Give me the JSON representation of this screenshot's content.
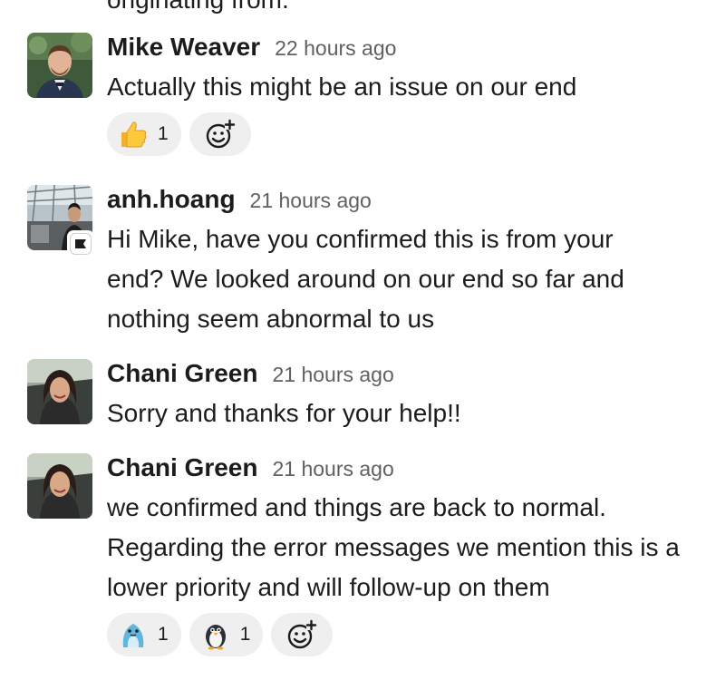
{
  "clipped_previous_line": "originating from.",
  "messages": [
    {
      "author": "Mike Weaver",
      "time": "22 hours ago",
      "text": "Actually this might be an issue on our end",
      "reactions": [
        {
          "emoji": "thumbs-up",
          "count": "1"
        }
      ]
    },
    {
      "author": "anh.hoang",
      "time": "21 hours ago",
      "text": "Hi Mike, have you confirmed this is from your end? We looked around on our end so far and nothing seem abnormal to us",
      "badge": "flag-icon"
    },
    {
      "author": "Chani Green",
      "time": "21 hours ago",
      "text": "Sorry and thanks for your help!!"
    },
    {
      "author": "Chani Green",
      "time": "21 hours ago",
      "text": "we confirmed and things are back to normal. Regarding the error messages we mention this is a lower priority and will follow-up on them",
      "reactions": [
        {
          "emoji": "blue-seal",
          "count": "1"
        },
        {
          "emoji": "penguin",
          "count": "1"
        }
      ]
    }
  ],
  "colors": {
    "text": "#1d1c1d",
    "timestamp": "#616061",
    "reaction_bg": "#efefef"
  }
}
